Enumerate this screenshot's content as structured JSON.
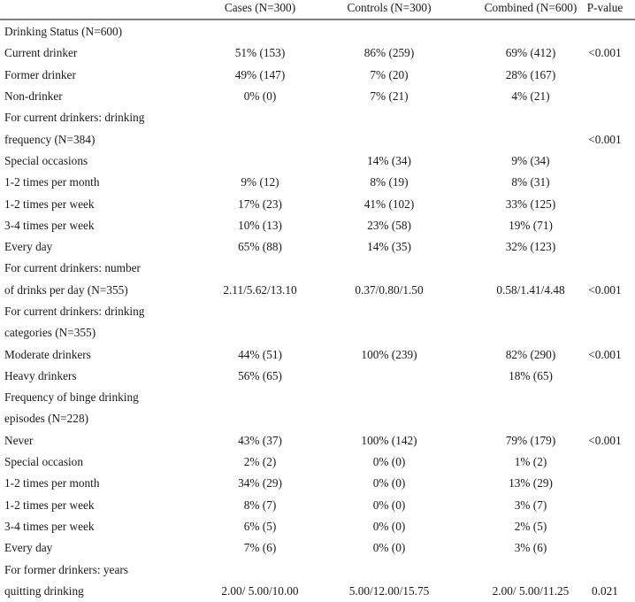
{
  "table": {
    "headers": {
      "label": "",
      "cases": "Cases (N=300)",
      "controls": "Controls (N=300)",
      "combined": "Combined (N=600)",
      "pvalue": "P-value"
    },
    "rows": [
      {
        "label": "Drinking Status (N=600)",
        "cases": "",
        "controls": "",
        "combined": "",
        "pvalue": ""
      },
      {
        "label": "Current drinker",
        "cases": "51% (153)",
        "controls": "86% (259)",
        "combined": "69% (412)",
        "pvalue": "<0.001"
      },
      {
        "label": "Former drinker",
        "cases": "49% (147)",
        "controls": "7% (20)",
        "combined": "28% (167)",
        "pvalue": ""
      },
      {
        "label": "Non-drinker",
        "cases": "0% (0)",
        "controls": "7% (21)",
        "combined": "4% (21)",
        "pvalue": ""
      },
      {
        "label": "For current drinkers: drinking",
        "cases": "",
        "controls": "",
        "combined": "",
        "pvalue": ""
      },
      {
        "label": "frequency (N=384)",
        "cases": "",
        "controls": "",
        "combined": "",
        "pvalue": "<0.001"
      },
      {
        "label": "Special occasions",
        "cases": "",
        "controls": "14% (34)",
        "combined": "9% (34)",
        "pvalue": ""
      },
      {
        "label": "1-2 times per month",
        "cases": "9% (12)",
        "controls": "8% (19)",
        "combined": "8% (31)",
        "pvalue": ""
      },
      {
        "label": "1-2 times per week",
        "cases": "17% (23)",
        "controls": "41% (102)",
        "combined": "33% (125)",
        "pvalue": ""
      },
      {
        "label": "3-4 times per week",
        "cases": "10% (13)",
        "controls": "23% (58)",
        "combined": "19% (71)",
        "pvalue": ""
      },
      {
        "label": "Every day",
        "cases": "65% (88)",
        "controls": "14% (35)",
        "combined": "32% (123)",
        "pvalue": ""
      },
      {
        "label": "For current drinkers: number",
        "cases": "",
        "controls": "",
        "combined": "",
        "pvalue": ""
      },
      {
        "label": "of drinks per day (N=355)",
        "cases": "2.11/5.62/13.10",
        "controls": "0.37/0.80/1.50",
        "combined": "0.58/1.41/4.48",
        "pvalue": "<0.001"
      },
      {
        "label": "For current drinkers: drinking",
        "cases": "",
        "controls": "",
        "combined": "",
        "pvalue": ""
      },
      {
        "label": "categories (N=355)",
        "cases": "",
        "controls": "",
        "combined": "",
        "pvalue": ""
      },
      {
        "label": "Moderate drinkers",
        "cases": "44% (51)",
        "controls": "100% (239)",
        "combined": "82% (290)",
        "pvalue": "<0.001"
      },
      {
        "label": "Heavy drinkers",
        "cases": "56% (65)",
        "controls": "",
        "combined": "18% (65)",
        "pvalue": ""
      },
      {
        "label": "Frequency of binge drinking",
        "cases": "",
        "controls": "",
        "combined": "",
        "pvalue": ""
      },
      {
        "label": "episodes (N=228)",
        "cases": "",
        "controls": "",
        "combined": "",
        "pvalue": ""
      },
      {
        "label": "Never",
        "cases": "43% (37)",
        "controls": "100% (142)",
        "combined": "79% (179)",
        "pvalue": "<0.001"
      },
      {
        "label": "Special occasion",
        "cases": "2% (2)",
        "controls": "0% (0)",
        "combined": "1% (2)",
        "pvalue": ""
      },
      {
        "label": "1-2 times per month",
        "cases": "34% (29)",
        "controls": "0% (0)",
        "combined": "13% (29)",
        "pvalue": ""
      },
      {
        "label": "1-2 times per week",
        "cases": "8% (7)",
        "controls": "0% (0)",
        "combined": "3% (7)",
        "pvalue": ""
      },
      {
        "label": "3-4 times per week",
        "cases": "6% (5)",
        "controls": "0% (0)",
        "combined": "2% (5)",
        "pvalue": ""
      },
      {
        "label": "Every day",
        "cases": "7% (6)",
        "controls": "0% (0)",
        "combined": "3% (6)",
        "pvalue": ""
      },
      {
        "label": "For former drinkers: years",
        "cases": "",
        "controls": "",
        "combined": "",
        "pvalue": ""
      },
      {
        "label": "quitting drinking",
        "cases": "2.00/ 5.00/10.00",
        "controls": "5.00/12.00/15.75",
        "combined": "2.00/ 5.00/11.25",
        "pvalue": "0.021"
      }
    ]
  }
}
